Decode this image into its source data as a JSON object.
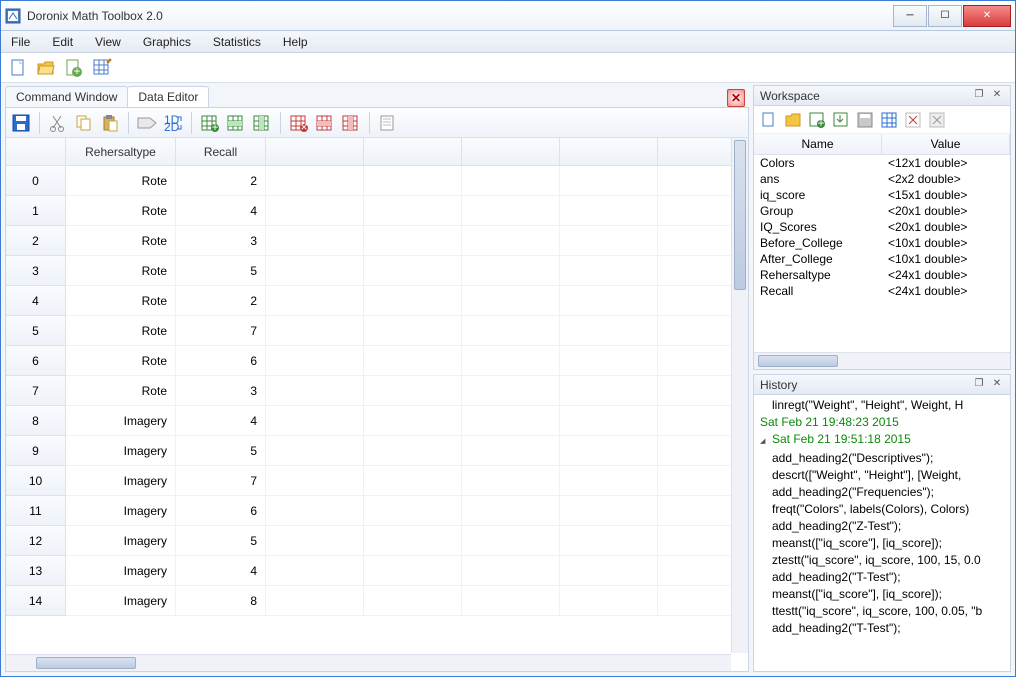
{
  "window": {
    "title": "Doronix Math Toolbox 2.0"
  },
  "menu": [
    "File",
    "Edit",
    "View",
    "Graphics",
    "Statistics",
    "Help"
  ],
  "tabs": {
    "command": "Command Window",
    "data": "Data Editor"
  },
  "columns": [
    "Rehersaltype",
    "Recall"
  ],
  "rows": [
    {
      "i": 0,
      "type": "Rote",
      "recall": 2
    },
    {
      "i": 1,
      "type": "Rote",
      "recall": 4
    },
    {
      "i": 2,
      "type": "Rote",
      "recall": 3
    },
    {
      "i": 3,
      "type": "Rote",
      "recall": 5
    },
    {
      "i": 4,
      "type": "Rote",
      "recall": 2
    },
    {
      "i": 5,
      "type": "Rote",
      "recall": 7
    },
    {
      "i": 6,
      "type": "Rote",
      "recall": 6,
      "sel": true
    },
    {
      "i": 7,
      "type": "Rote",
      "recall": 3
    },
    {
      "i": 8,
      "type": "Imagery",
      "recall": 4
    },
    {
      "i": 9,
      "type": "Imagery",
      "recall": 5
    },
    {
      "i": 10,
      "type": "Imagery",
      "recall": 7
    },
    {
      "i": 11,
      "type": "Imagery",
      "recall": 6
    },
    {
      "i": 12,
      "type": "Imagery",
      "recall": 5
    },
    {
      "i": 13,
      "type": "Imagery",
      "recall": 4
    },
    {
      "i": 14,
      "type": "Imagery",
      "recall": 8
    }
  ],
  "workspace": {
    "title": "Workspace",
    "headers": {
      "name": "Name",
      "value": "Value"
    },
    "vars": [
      {
        "name": "Colors",
        "value": "<12x1 double>"
      },
      {
        "name": "ans",
        "value": "<2x2 double>"
      },
      {
        "name": "iq_score",
        "value": "<15x1 double>"
      },
      {
        "name": "Group",
        "value": "<20x1 double>"
      },
      {
        "name": "IQ_Scores",
        "value": "<20x1 double>"
      },
      {
        "name": "Before_College",
        "value": "<10x1 double>"
      },
      {
        "name": "After_College",
        "value": "<10x1 double>"
      },
      {
        "name": "Rehersaltype",
        "value": "<24x1 double>"
      },
      {
        "name": "Recall",
        "value": "<24x1 double>"
      }
    ]
  },
  "history": {
    "title": "History",
    "lines": [
      {
        "t": "linregt(\"Weight\", \"Height\", Weight, H"
      },
      {
        "t": "Sat Feb 21 19:48:23 2015",
        "date": true
      },
      {
        "t": "Sat Feb 21 19:51:18 2015",
        "date": true,
        "tri": true
      },
      {
        "t": "add_heading2(\"Descriptives\");"
      },
      {
        "t": "descrt([\"Weight\", \"Height\"], [Weight,"
      },
      {
        "t": "add_heading2(\"Frequencies\");"
      },
      {
        "t": "freqt(\"Colors\", labels(Colors), Colors)"
      },
      {
        "t": "add_heading2(\"Z-Test\");"
      },
      {
        "t": "meanst([\"iq_score\"], [iq_score]);"
      },
      {
        "t": "ztestt(\"iq_score\", iq_score, 100, 15, 0.0"
      },
      {
        "t": "add_heading2(\"T-Test\");"
      },
      {
        "t": "meanst([\"iq_score\"], [iq_score]);"
      },
      {
        "t": "ttestt(\"iq_score\", iq_score, 100, 0.05, \"b"
      },
      {
        "t": "add_heading2(\"T-Test\");"
      }
    ]
  }
}
